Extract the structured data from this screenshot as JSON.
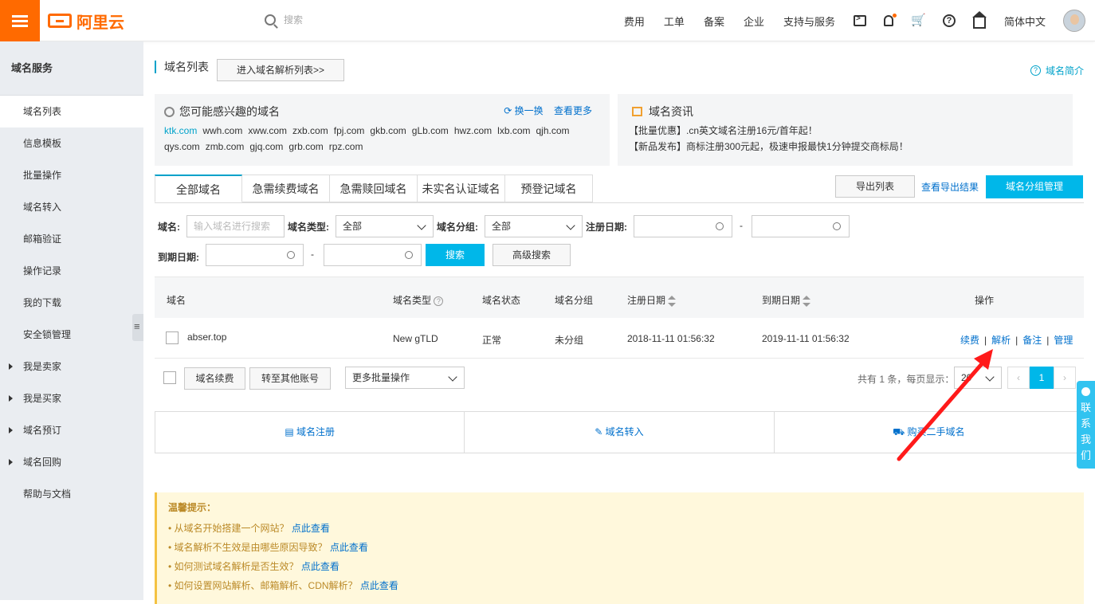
{
  "header": {
    "search_placeholder": "搜索",
    "nav": [
      "费用",
      "工单",
      "备案",
      "企业",
      "支持与服务"
    ],
    "lang": "简体中文"
  },
  "logo": {
    "text": "阿里云"
  },
  "sidebar": {
    "title": "域名服务",
    "items": [
      "域名列表",
      "信息模板",
      "批量操作",
      "域名转入",
      "邮箱验证",
      "操作记录",
      "我的下载",
      "安全锁管理"
    ],
    "groups": [
      "我是卖家",
      "我是买家",
      "域名预订",
      "域名回购"
    ],
    "help": "帮助与文档"
  },
  "page": {
    "title": "域名列表",
    "enter_dns": "进入域名解析列表>>",
    "intro": "域名简介"
  },
  "suggest": {
    "title": "您可能感兴趣的域名",
    "refresh": "换一换",
    "more": "查看更多",
    "domains": [
      "ktk.com",
      "wwh.com",
      "xww.com",
      "zxb.com",
      "fpj.com",
      "gkb.com",
      "gLb.com",
      "hwz.com",
      "lxb.com",
      "qjh.com",
      "qys.com",
      "zmb.com",
      "gjq.com",
      "grb.com",
      "rpz.com"
    ]
  },
  "news": {
    "title": "域名资讯",
    "items": [
      "【批量优惠】.cn英文域名注册16元/首年起！",
      "【新品发布】商标注册300元起，极速申报最快1分钟提交商标局！"
    ]
  },
  "tabs": [
    "全部域名",
    "急需续费域名",
    "急需赎回域名",
    "未实名认证域名",
    "预登记域名"
  ],
  "actions": {
    "export": "导出列表",
    "view_export": "查看导出结果",
    "group_manage": "域名分组管理"
  },
  "filters": {
    "domain_label": "域名:",
    "domain_placeholder": "输入域名进行搜索",
    "type_label": "域名类型:",
    "type_value": "全部",
    "group_label": "域名分组:",
    "group_value": "全部",
    "reg_label": "注册日期:",
    "exp_label": "到期日期:",
    "dash": "-",
    "search": "搜索",
    "advanced": "高级搜索"
  },
  "table": {
    "headers": {
      "domain": "域名",
      "type": "域名类型",
      "status": "域名状态",
      "group": "域名分组",
      "reg": "注册日期",
      "exp": "到期日期",
      "ops": "操作"
    },
    "rows": [
      {
        "domain": "abser.top",
        "type": "New gTLD",
        "status": "正常",
        "group": "未分组",
        "reg": "2018-11-11 01:56:32",
        "exp": "2019-11-11 01:56:32"
      }
    ],
    "ops": [
      "续费",
      "解析",
      "备注",
      "管理"
    ],
    "sep": "|"
  },
  "bulk": {
    "renew": "域名续费",
    "transfer": "转至其他账号",
    "more": "更多批量操作",
    "total": "共有 1 条，每页显示：",
    "page_size": "20",
    "page": "1",
    "prev": "‹",
    "next": "›"
  },
  "quick": [
    "域名注册",
    "域名转入",
    "购买二手域名"
  ],
  "tips": {
    "title": "温馨提示：",
    "items": [
      {
        "q": "从域名开始搭建一个网站？",
        "a": "点此查看"
      },
      {
        "q": "域名解析不生效是由哪些原因导致？",
        "a": "点此查看"
      },
      {
        "q": "如何测试域名解析是否生效？",
        "a": "点此查看"
      },
      {
        "q": "如何设置网站解析、邮箱解析、CDN解析？",
        "a": "点此查看"
      }
    ]
  },
  "contact": "联系我们",
  "colors": {
    "brand": "#ff6a00",
    "accent": "#00b7e9",
    "link": "#0070cc",
    "arrow": "#ff1a1a"
  }
}
